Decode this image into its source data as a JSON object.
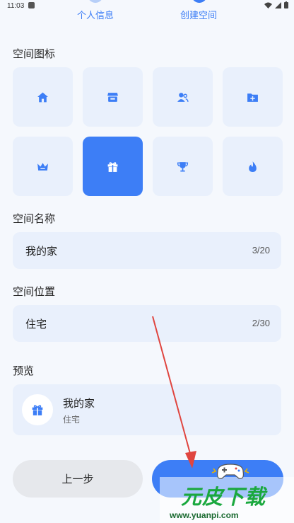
{
  "statusbar": {
    "time": "11:03"
  },
  "stepper": {
    "step1_label": "个人信息",
    "step2_label": "创建空间"
  },
  "icons_section": {
    "title": "空间图标",
    "icons": [
      "home-icon",
      "store-icon",
      "people-icon",
      "folder-plus-icon",
      "crown-icon",
      "gift-icon",
      "trophy-icon",
      "flame-icon"
    ],
    "selected": "gift-icon"
  },
  "name_section": {
    "title": "空间名称",
    "value": "我的家",
    "count": "3/20"
  },
  "location_section": {
    "title": "空间位置",
    "value": "住宅",
    "count": "2/30"
  },
  "preview_section": {
    "title": "预览",
    "name": "我的家",
    "location": "住宅",
    "icon": "gift-icon"
  },
  "buttons": {
    "prev_label": "上一步"
  },
  "watermark": {
    "logo": "元皮下载",
    "url": "www.yuanpi.com"
  },
  "colors": {
    "accent": "#3d7ef6",
    "tile_bg": "#e9f0fc",
    "page_bg": "#f5f8fd",
    "arrow": "#e0453f",
    "watermark_green": "#1aa83e"
  }
}
